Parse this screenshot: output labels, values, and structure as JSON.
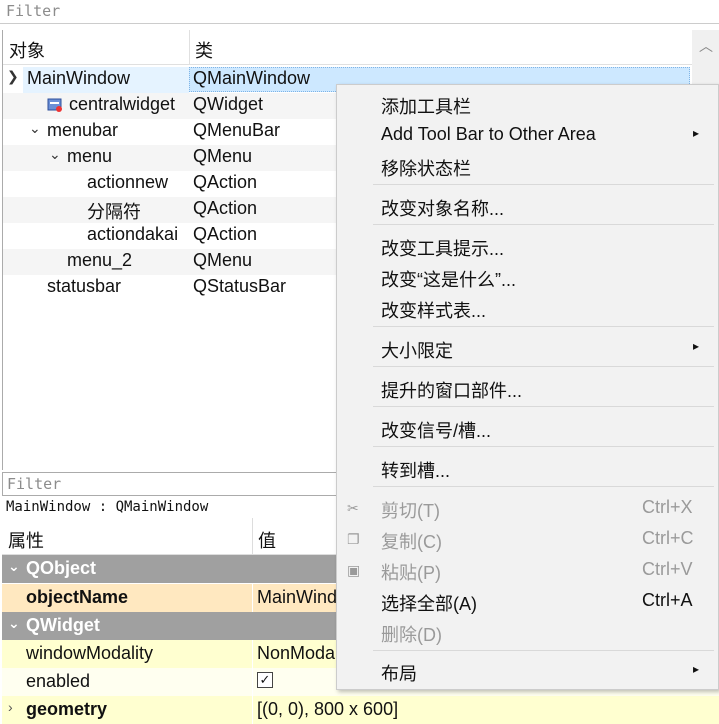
{
  "object_inspector": {
    "filter_placeholder": "Filter",
    "headers": {
      "object": "对象",
      "class": "类"
    },
    "rows": [
      {
        "name": "MainWindow",
        "class": "QMainWindow"
      },
      {
        "name": "centralwidget",
        "class": "QWidget"
      },
      {
        "name": "menubar",
        "class": "QMenuBar"
      },
      {
        "name": "menu",
        "class": "QMenu"
      },
      {
        "name": "actionnew",
        "class": "QAction"
      },
      {
        "name": "分隔符",
        "class": "QAction"
      },
      {
        "name": "actiondakai",
        "class": "QAction"
      },
      {
        "name": "menu_2",
        "class": "QMenu"
      },
      {
        "name": "statusbar",
        "class": "QStatusBar"
      }
    ]
  },
  "property_editor": {
    "filter_placeholder": "Filter",
    "object_info": "MainWindow : QMainWindow",
    "headers": {
      "property": "属性",
      "value": "值"
    },
    "rows": [
      {
        "key": "QObject",
        "value": ""
      },
      {
        "key": "objectName",
        "value": "MainWind"
      },
      {
        "key": "QWidget",
        "value": ""
      },
      {
        "key": "windowModality",
        "value": "NonModa"
      },
      {
        "key": "enabled",
        "value": "✓"
      },
      {
        "key": "geometry",
        "value": "[(0, 0), 800 x 600]"
      }
    ]
  },
  "context_menu": {
    "items": [
      {
        "label": "添加工具栏"
      },
      {
        "label": "Add Tool Bar to Other Area"
      },
      {
        "label": "移除状态栏"
      },
      {
        "label": "改变对象名称..."
      },
      {
        "label": "改变工具提示..."
      },
      {
        "label": "改变“这是什么”..."
      },
      {
        "label": "改变样式表..."
      },
      {
        "label": "大小限定"
      },
      {
        "label": "提升的窗口部件..."
      },
      {
        "label": "改变信号/槽..."
      },
      {
        "label": "转到槽..."
      },
      {
        "label": "剪切(T)",
        "shortcut": "Ctrl+X"
      },
      {
        "label": "复制(C)",
        "shortcut": "Ctrl+C"
      },
      {
        "label": "粘贴(P)",
        "shortcut": "Ctrl+V"
      },
      {
        "label": "选择全部(A)",
        "shortcut": "Ctrl+A"
      },
      {
        "label": "删除(D)"
      },
      {
        "label": "布局"
      }
    ]
  },
  "icons": {
    "submenu_arrow": "▸",
    "expanded_arrow": "⌄",
    "collapsed_arrow": "›",
    "scroll_up": "chevron-up-icon",
    "cut_icon": "scissors-icon",
    "copy_icon": "copy-icon",
    "paste_icon": "paste-icon",
    "widget_icon": "widget-icon"
  },
  "colors": {
    "selection": "#cde8ff",
    "group_header": "#a0a0a0",
    "menu_bg": "#f2f2f2",
    "disabled_text": "#9a9a9a"
  }
}
